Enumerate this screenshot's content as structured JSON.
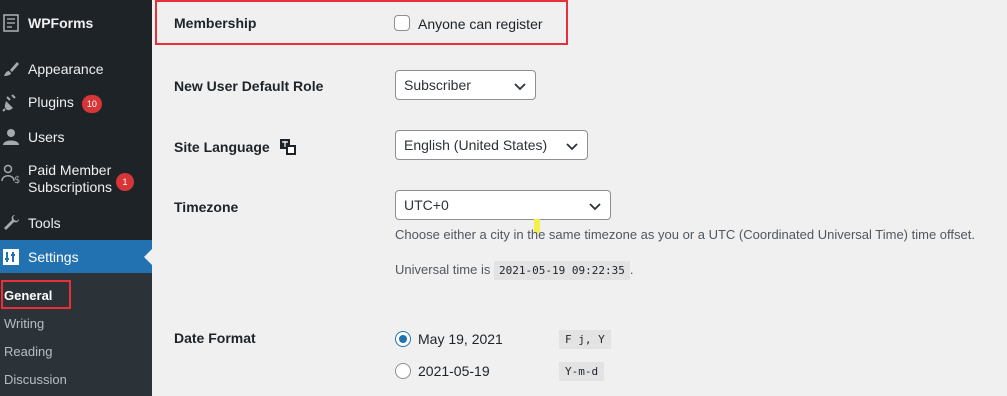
{
  "sidebar": {
    "items": [
      {
        "label": "WPForms",
        "icon": "wpforms-icon"
      },
      {
        "label": "Appearance",
        "icon": "paintbrush-icon"
      },
      {
        "label": "Plugins",
        "icon": "plugin-icon",
        "badge": "10"
      },
      {
        "label": "Users",
        "icon": "user-icon"
      },
      {
        "label": "Paid Member",
        "label2": "Subscriptions",
        "icon": "paid-member-icon",
        "badge": "1"
      },
      {
        "label": "Tools",
        "icon": "wrench-icon"
      },
      {
        "label": "Settings",
        "icon": "settings-icon"
      }
    ],
    "submenu": [
      "General",
      "Writing",
      "Reading",
      "Discussion"
    ]
  },
  "settings": {
    "membership": {
      "label": "Membership",
      "checkbox_label": "Anyone can register"
    },
    "default_role": {
      "label": "New User Default Role",
      "value": "Subscriber"
    },
    "site_language": {
      "label": "Site Language",
      "value": "English (United States)"
    },
    "timezone": {
      "label": "Timezone",
      "value": "UTC+0",
      "description": "Choose either a city in the same timezone as you or a UTC (Coordinated Universal Time) time offset.",
      "universal_prefix": "Universal time is",
      "universal_value": "2021-05-19 09:22:35",
      "universal_suffix": "."
    },
    "date_format": {
      "label": "Date Format",
      "options": [
        {
          "label": "May 19, 2021",
          "code": "F j, Y"
        },
        {
          "label": "2021-05-19",
          "code": "Y-m-d"
        }
      ]
    }
  },
  "colors": {
    "accent": "#2271b1",
    "sidebar_bg": "#1d2327",
    "highlight_box": "#e8303b",
    "badge": "#d63638"
  }
}
